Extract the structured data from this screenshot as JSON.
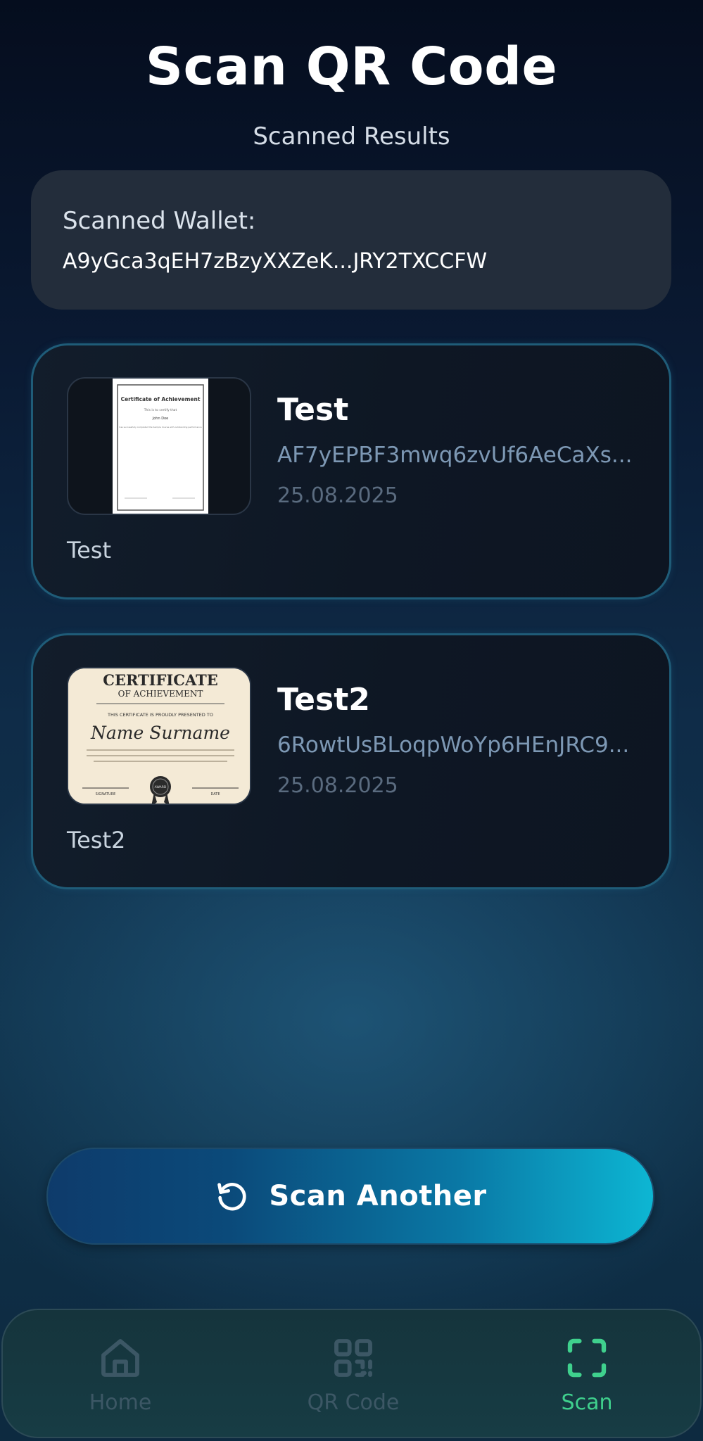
{
  "header": {
    "title": "Scan QR Code",
    "subtitle": "Scanned Results"
  },
  "wallet": {
    "label": "Scanned Wallet:",
    "value": "A9yGca3qEH7zBzyXXZeK...JRY2TXCCFW"
  },
  "certificates": [
    {
      "name": "Test",
      "address": "AF7yEPBF3mwq6zvUf6AeCaXs...",
      "date": "25.08.2025",
      "description": "Test",
      "thumbnail": {
        "title": "Certificate of Achievement",
        "subtitle": "This is to certify that",
        "recipient": "John Doe",
        "body": "has successfully completed the Sample Course with outstanding performance"
      }
    },
    {
      "name": "Test2",
      "address": "6RowtUsBLoqpWoYp6HEnJRC9...",
      "date": "25.08.2025",
      "description": "Test2",
      "thumbnail": {
        "title": "CERTIFICATE",
        "subtitle": "OF ACHIEVEMENT",
        "presented": "THIS CERTIFICATE IS PROUDLY PRESENTED TO",
        "recipient": "Name Surname",
        "signature": "SIGNATURE",
        "date_label": "DATE",
        "seal": "AWARD"
      }
    }
  ],
  "scan_button": {
    "label": "Scan Another",
    "icon": "refresh-icon"
  },
  "nav": {
    "items": [
      {
        "label": "Home",
        "icon": "home-icon",
        "active": false
      },
      {
        "label": "QR Code",
        "icon": "qr-code-icon",
        "active": false
      },
      {
        "label": "Scan",
        "icon": "scan-icon",
        "active": true
      }
    ]
  },
  "colors": {
    "accent_active": "#3fd08d",
    "inactive": "#3c5765",
    "button_gradient_start": "#0e3b6b",
    "button_gradient_end": "#0db6d3"
  }
}
